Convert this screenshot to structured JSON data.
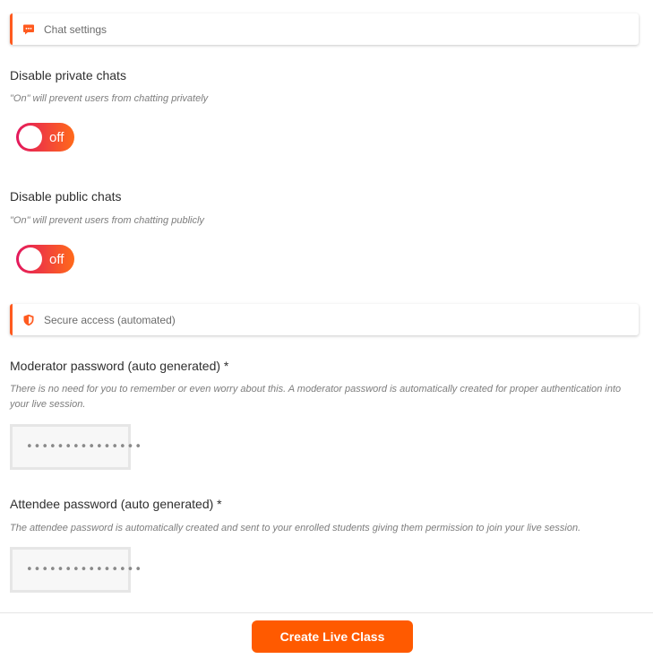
{
  "chat_settings": {
    "header": "Chat settings",
    "private_chats": {
      "label": "Disable private chats",
      "hint": "\"On\" will prevent users from chatting privately",
      "toggle_state": "off"
    },
    "public_chats": {
      "label": "Disable public chats",
      "hint": "\"On\" will prevent users from chatting publicly",
      "toggle_state": "off"
    }
  },
  "secure_access": {
    "header": "Secure access (automated)",
    "moderator_password": {
      "label": "Moderator password (auto generated) *",
      "hint": "There is no need for you to remember or even worry about this. A moderator password is automatically created for proper authentication into your live session.",
      "value": "•••••••••••••••"
    },
    "attendee_password": {
      "label": "Attendee password (auto generated) *",
      "hint": "The attendee password is automatically created and sent to your enrolled students giving them permission to join your live session.",
      "value": "•••••••••••••••"
    }
  },
  "footer": {
    "create_button": "Create Live Class"
  },
  "colors": {
    "accent": "#ff5a00",
    "toggle_gradient_start": "#e3185e",
    "toggle_gradient_end": "#ff6a1a"
  },
  "icons": {
    "chat_header": "chat-bubble-icon",
    "secure_header": "shield-icon"
  }
}
